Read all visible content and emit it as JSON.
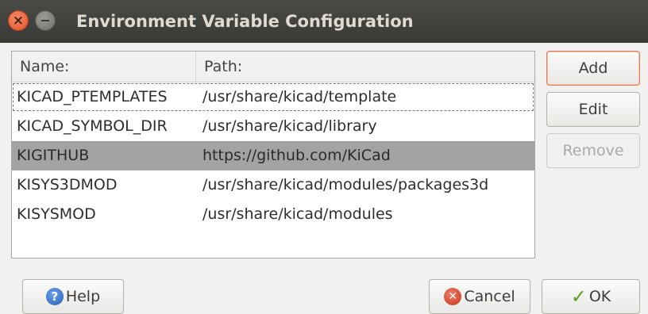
{
  "window": {
    "title": "Environment Variable Configuration",
    "close_glyph": "×"
  },
  "table": {
    "columns": [
      "Name:",
      "Path:"
    ],
    "rows": [
      {
        "name": "KICAD_PTEMPLATES",
        "path": "/usr/share/kicad/template"
      },
      {
        "name": "KICAD_SYMBOL_DIR",
        "path": "/usr/share/kicad/library"
      },
      {
        "name": "KIGITHUB",
        "path": "https://github.com/KiCad"
      },
      {
        "name": "KISYS3DMOD",
        "path": "/usr/share/kicad/modules/packages3d"
      },
      {
        "name": "KISYSMOD",
        "path": "/usr/share/kicad/modules"
      }
    ],
    "selected_row": "KIGITHUB"
  },
  "side_buttons": {
    "add_label": "Add",
    "edit_label": "Edit",
    "remove_label": "Remove"
  },
  "footer": {
    "help_label": "Help",
    "cancel_label": "Cancel",
    "ok_label": "OK",
    "help_icon": "question-icon",
    "cancel_icon": "cancel-icon",
    "ok_icon": "checkmark-icon"
  },
  "colors": {
    "titlebar": "#3c3b37",
    "selection": "#a3a3a3",
    "default_button_border": "#e27c57"
  }
}
